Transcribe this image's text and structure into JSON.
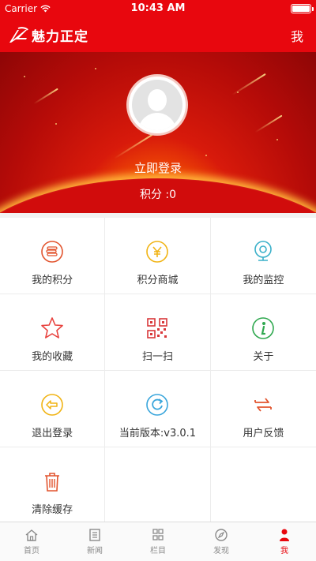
{
  "status": {
    "carrier": "Carrier",
    "time": "10:43 AM"
  },
  "header": {
    "app_title": "魅力正定",
    "right_label": "我"
  },
  "profile": {
    "login_label": "立即登录",
    "points_label": "积分 :0"
  },
  "menu": [
    {
      "label": "我的积分",
      "icon": "coins-icon",
      "color": "#e2542e"
    },
    {
      "label": "积分商城",
      "icon": "yen-coin-icon",
      "color": "#f1b415"
    },
    {
      "label": "我的监控",
      "icon": "webcam-icon",
      "color": "#3ab0c9"
    },
    {
      "label": "我的收藏",
      "icon": "star-icon",
      "color": "#e8413d"
    },
    {
      "label": "扫一扫",
      "icon": "qr-code-icon",
      "color": "#d9383a"
    },
    {
      "label": "关于",
      "icon": "info-icon",
      "color": "#2fa84f"
    },
    {
      "label": "退出登录",
      "icon": "exit-arrow-icon",
      "color": "#f1b415"
    },
    {
      "label": "当前版本:v3.0.1",
      "icon": "refresh-icon",
      "color": "#3aa6dc"
    },
    {
      "label": "用户反馈",
      "icon": "swap-arrows-icon",
      "color": "#e2542e"
    },
    {
      "label": "清除缓存",
      "icon": "trash-icon",
      "color": "#e2542e"
    }
  ],
  "tabs": [
    {
      "label": "首页",
      "icon": "home-icon"
    },
    {
      "label": "新闻",
      "icon": "news-icon"
    },
    {
      "label": "栏目",
      "icon": "grid-icon"
    },
    {
      "label": "发现",
      "icon": "compass-icon"
    },
    {
      "label": "我",
      "icon": "person-icon",
      "active": true
    }
  ],
  "colors": {
    "brand_red": "#e8070e",
    "active_tab": "#e8070e",
    "inactive_tab": "#8a8a8a"
  }
}
